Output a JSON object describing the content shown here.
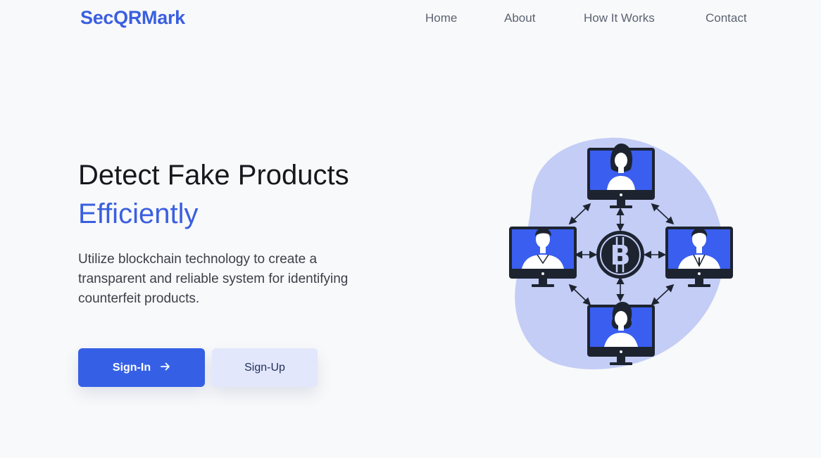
{
  "header": {
    "brand": "SecQRMark",
    "nav": [
      {
        "label": "Home"
      },
      {
        "label": "About"
      },
      {
        "label": "How It Works"
      },
      {
        "label": "Contact"
      }
    ]
  },
  "hero": {
    "title": "Detect Fake Products",
    "accent": "Efficiently",
    "description": "Utilize blockchain technology to create a transparent and reliable system for identifying counterfeit products."
  },
  "buttons": {
    "signin_label": "Sign-In",
    "signin_icon": "arrow-right-icon",
    "signup_label": "Sign-Up"
  },
  "illustration": {
    "center_icon": "bitcoin-icon",
    "blob_color": "#c3cdf6",
    "screen_color": "#3a5ef0"
  },
  "colors": {
    "accent": "#3b5fe0",
    "primary_button": "#3560e6",
    "secondary_button": "#e3e7fb",
    "background": "#f8f9fa"
  }
}
